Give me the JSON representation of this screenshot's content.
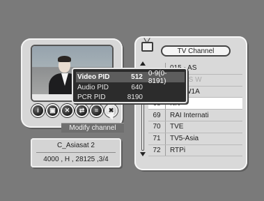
{
  "preview": {
    "buttons": [
      {
        "icon": "info-icon",
        "glyph": "i"
      },
      {
        "icon": "lock-icon",
        "glyph": "▣"
      },
      {
        "icon": "delete-icon",
        "glyph": "✕"
      },
      {
        "icon": "move-icon",
        "glyph": "⇄"
      },
      {
        "icon": "skip-icon",
        "glyph": "≡"
      },
      {
        "icon": "modify-icon",
        "glyph": "✖"
      }
    ],
    "tooltip": "Modify channel"
  },
  "pid_popup": {
    "rows": [
      {
        "label": "Video PID",
        "value": "512",
        "range": "0-9(0-8191)",
        "active": true
      },
      {
        "label": "Audio PID",
        "value": "640",
        "range": "",
        "active": false
      },
      {
        "label": "PCR PID",
        "value": "8190",
        "range": "",
        "active": false
      }
    ]
  },
  "satellite": {
    "name": "C_Asiasat 2",
    "params": "4000 , H , 28125 ,3/4"
  },
  "channel_list": {
    "title": "TV Channel",
    "rows": [
      {
        "num": "",
        "name": "015 - AS",
        "state": "normal"
      },
      {
        "num": "",
        "name": "STERS W",
        "state": "dim"
      },
      {
        "num": "",
        "name": "GJMW1A",
        "state": "normal"
      },
      {
        "num": "68",
        "name": "NN",
        "state": "highlight"
      },
      {
        "num": "69",
        "name": "RAI Internati",
        "state": "normal"
      },
      {
        "num": "70",
        "name": "TVE",
        "state": "normal"
      },
      {
        "num": "71",
        "name": "TV5-Asia",
        "state": "normal"
      },
      {
        "num": "72",
        "name": "RTPi",
        "state": "normal"
      }
    ]
  }
}
